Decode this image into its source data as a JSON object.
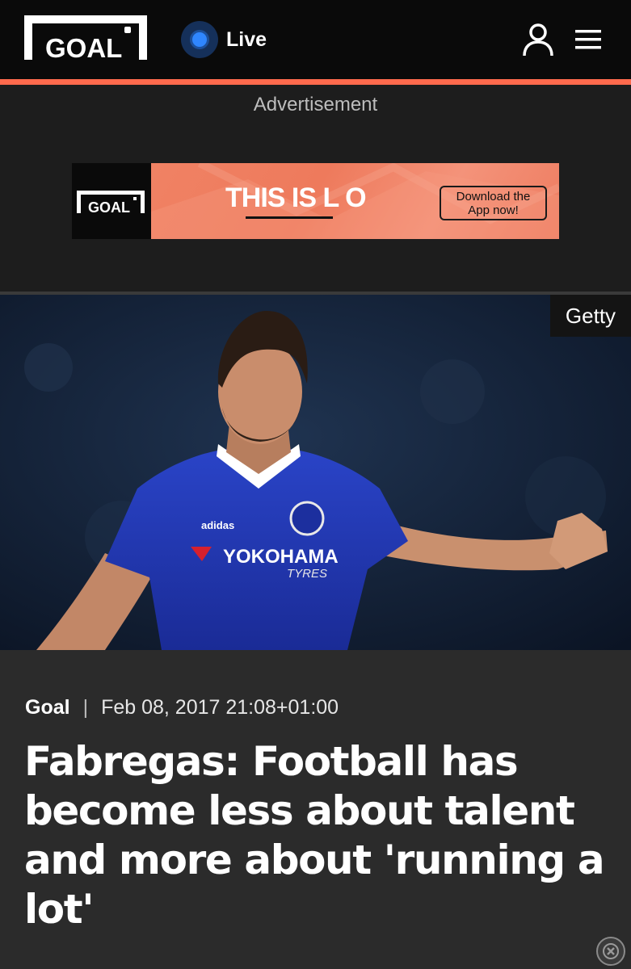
{
  "header": {
    "logo_text": "GOAL",
    "live_label": "Live",
    "icons": {
      "user": "user-icon",
      "menu": "menu-icon",
      "live": "live-dot-icon"
    },
    "accent_color": "#ff6a4d"
  },
  "ad": {
    "label": "Advertisement",
    "logo_text": "GOAL",
    "headline": "THIS IS L  O",
    "cta_line1": "Download the",
    "cta_line2": "App now!",
    "background_color": "#ee7a5c"
  },
  "hero": {
    "credit": "Getty",
    "shirt_brand": "adidas",
    "shirt_sponsor_line1": "YOKOHAMA",
    "shirt_sponsor_line2": "TYRES"
  },
  "article": {
    "source": "Goal",
    "separator": "|",
    "date": "Feb 08, 2017 21:08+01:00",
    "headline": "Fabregas: Football has become less about talent and more about 'running a lot'"
  },
  "overlay": {
    "close_icon": "close-icon"
  }
}
